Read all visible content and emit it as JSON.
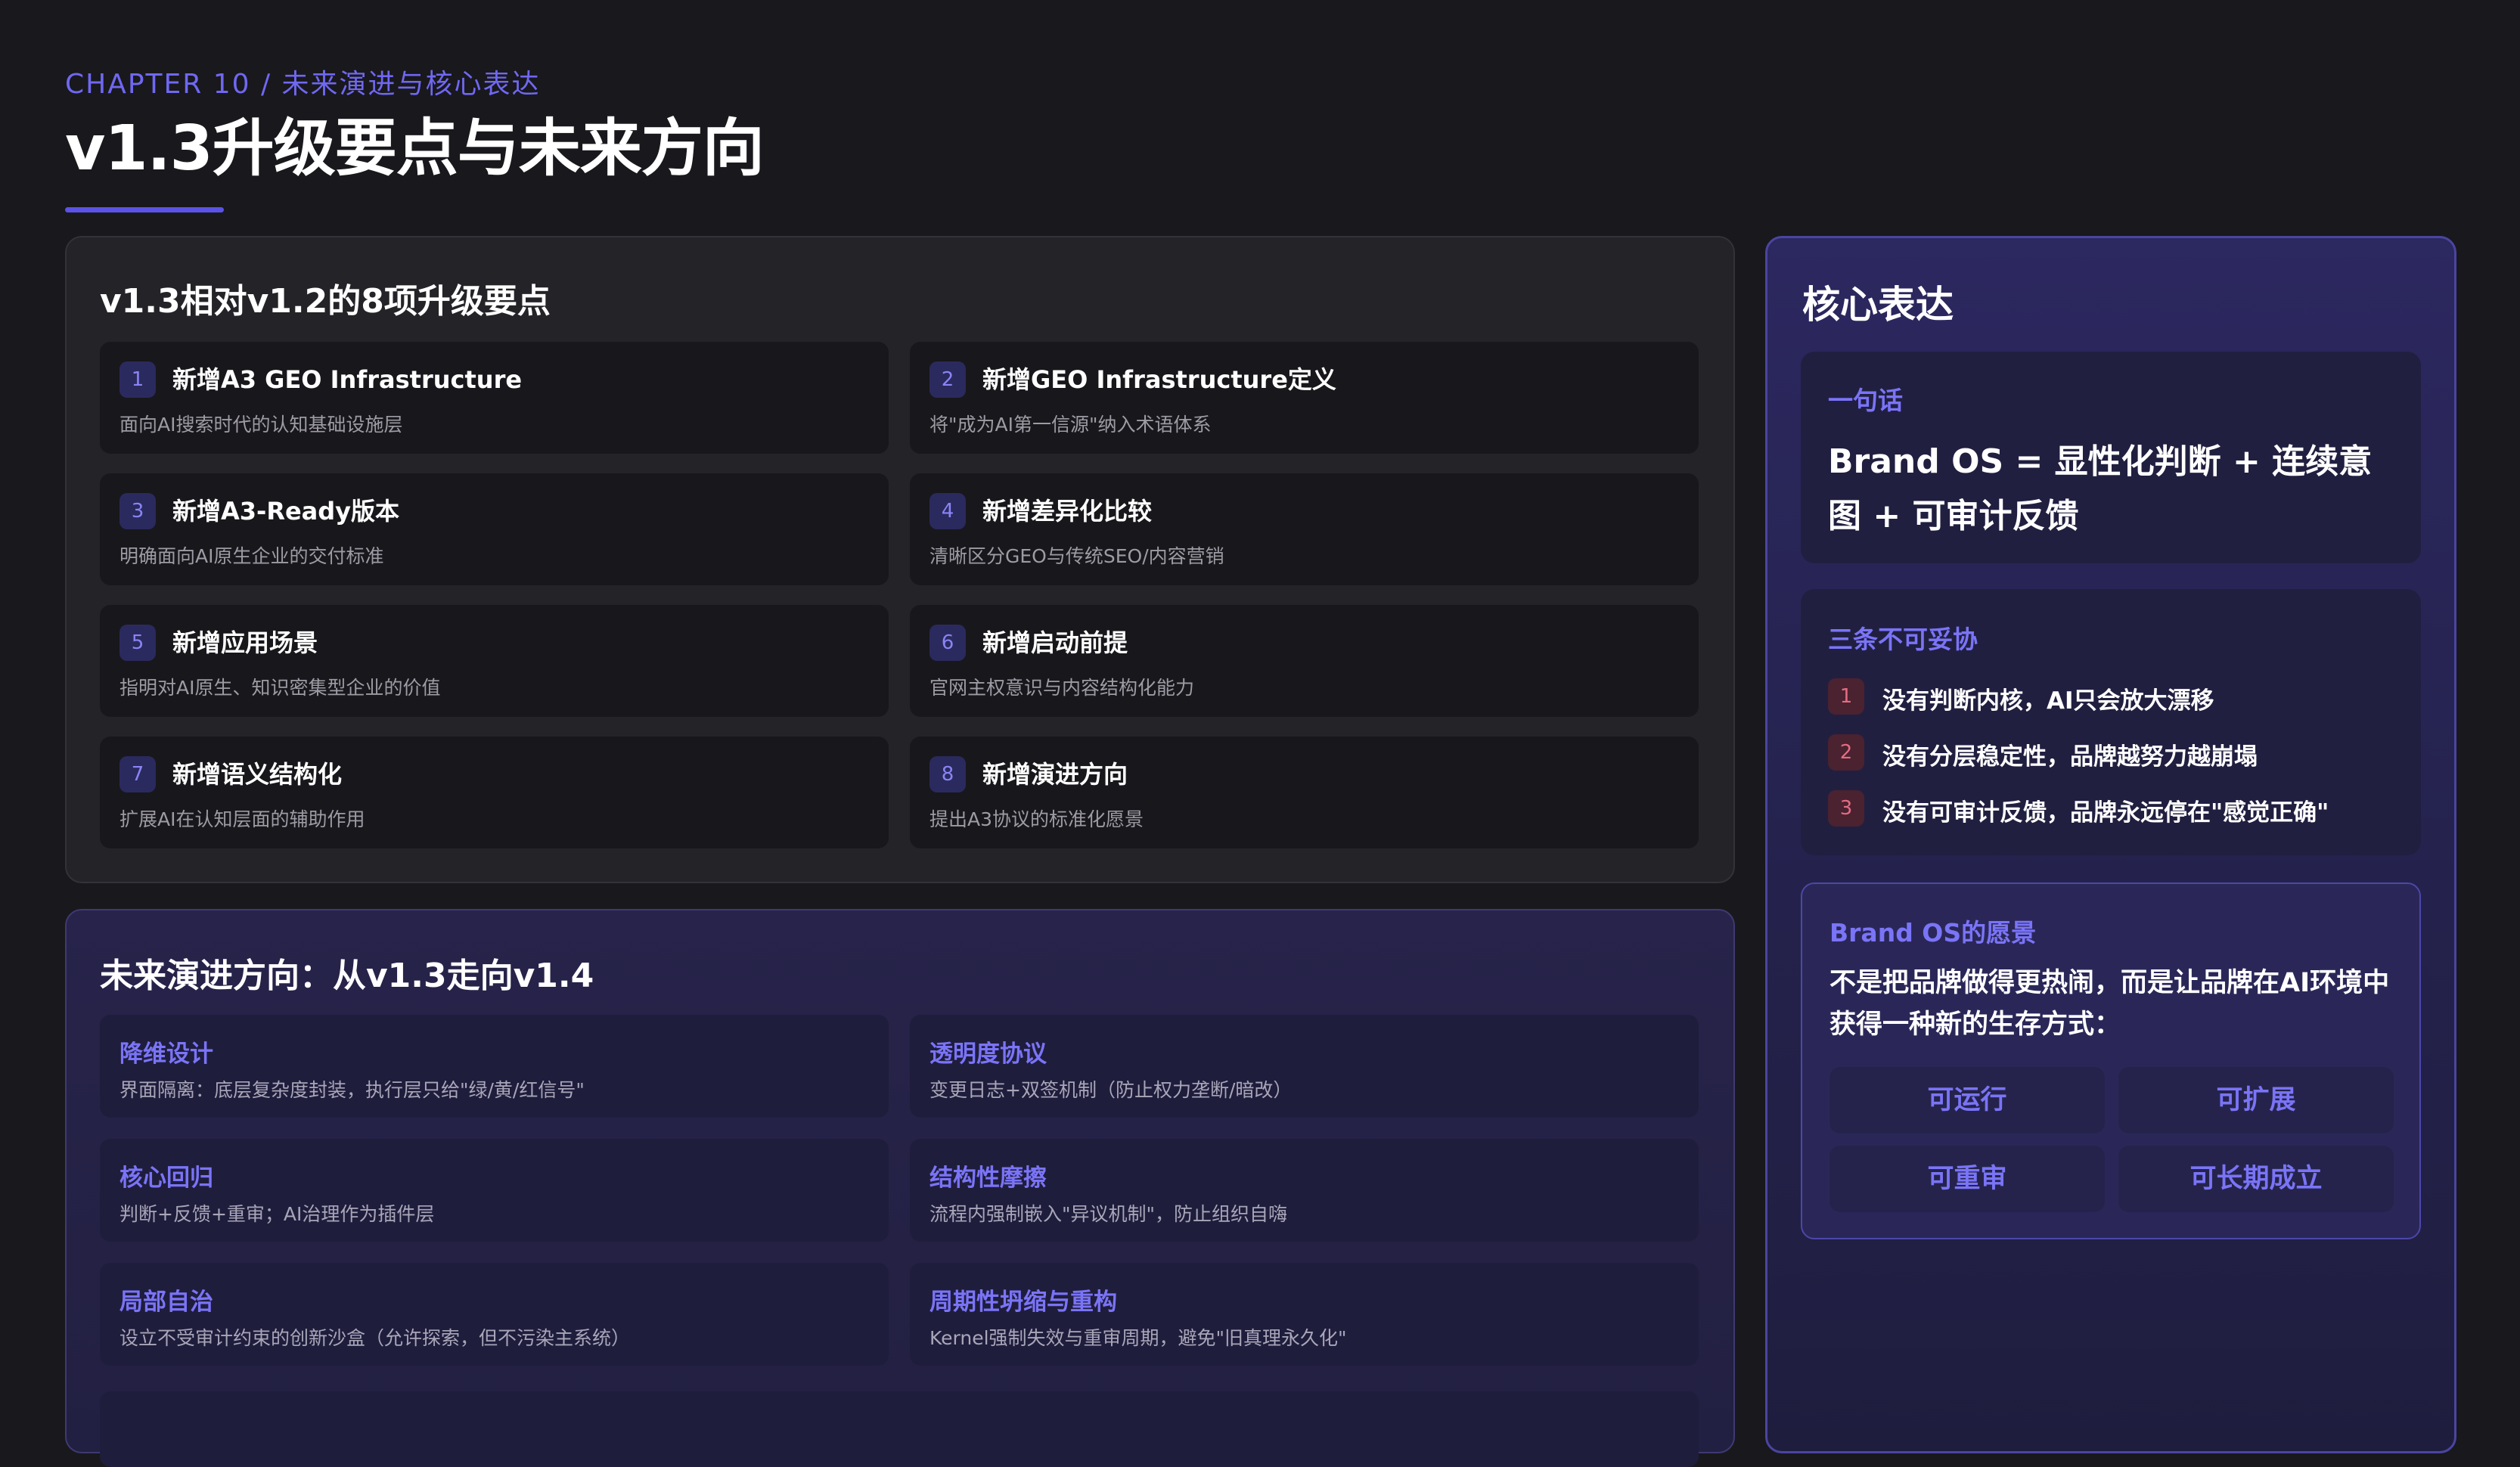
{
  "header": {
    "chapter": "CHAPTER 10 / 未来演进与核心表达",
    "title": "v1.3升级要点与未来方向"
  },
  "upgrades": {
    "title": "v1.3相对v1.2的8项升级要点",
    "items": [
      {
        "num": "1",
        "title": "新增A3 GEO Infrastructure",
        "desc": "面向AI搜索时代的认知基础设施层"
      },
      {
        "num": "2",
        "title": "新增GEO Infrastructure定义",
        "desc": "将\"成为AI第一信源\"纳入术语体系"
      },
      {
        "num": "3",
        "title": "新增A3-Ready版本",
        "desc": "明确面向AI原生企业的交付标准"
      },
      {
        "num": "4",
        "title": "新增差异化比较",
        "desc": "清晰区分GEO与传统SEO/内容营销"
      },
      {
        "num": "5",
        "title": "新增应用场景",
        "desc": "指明对AI原生、知识密集型企业的价值"
      },
      {
        "num": "6",
        "title": "新增启动前提",
        "desc": "官网主权意识与内容结构化能力"
      },
      {
        "num": "7",
        "title": "新增语义结构化",
        "desc": "扩展AI在认知层面的辅助作用"
      },
      {
        "num": "8",
        "title": "新增演进方向",
        "desc": "提出A3协议的标准化愿景"
      }
    ]
  },
  "future": {
    "title": "未来演进方向：从v1.3走向v1.4",
    "items": [
      {
        "title": "降维设计",
        "desc": "界面隔离：底层复杂度封装，执行层只给\"绿/黄/红信号\""
      },
      {
        "title": "透明度协议",
        "desc": "变更日志+双签机制（防止权力垄断/暗改）"
      },
      {
        "title": "核心回归",
        "desc": "判断+反馈+重审；AI治理作为插件层"
      },
      {
        "title": "结构性摩擦",
        "desc": "流程内强制嵌入\"异议机制\"，防止组织自嗨"
      },
      {
        "title": "局部自治",
        "desc": "设立不受审计约束的创新沙盒（允许探索，但不污染主系统）"
      },
      {
        "title": "周期性坍缩与重构",
        "desc": "Kernel强制失效与重审周期，避免\"旧真理永久化\""
      }
    ]
  },
  "core": {
    "title": "核心表达",
    "oneline": {
      "label": "一句话",
      "formula": "Brand OS = 显性化判断 + 连续意图 + 可审计反馈"
    },
    "three": {
      "label": "三条不可妥协",
      "items": [
        {
          "num": "1",
          "text": "没有判断内核，AI只会放大漂移"
        },
        {
          "num": "2",
          "text": "没有分层稳定性，品牌越努力越崩塌"
        },
        {
          "num": "3",
          "text": "没有可审计反馈，品牌永远停在\"感觉正确\""
        }
      ]
    },
    "vision": {
      "label": "Brand OS的愿景",
      "text": "不是把品牌做得更热闹，而是让品牌在AI环境中获得一种新的生存方式：",
      "pills": [
        "可运行",
        "可扩展",
        "可重审",
        "可长期成立"
      ]
    }
  },
  "colors": {
    "background": "#19181c",
    "accent": "#6f68f2",
    "danger": "#e56b82"
  }
}
